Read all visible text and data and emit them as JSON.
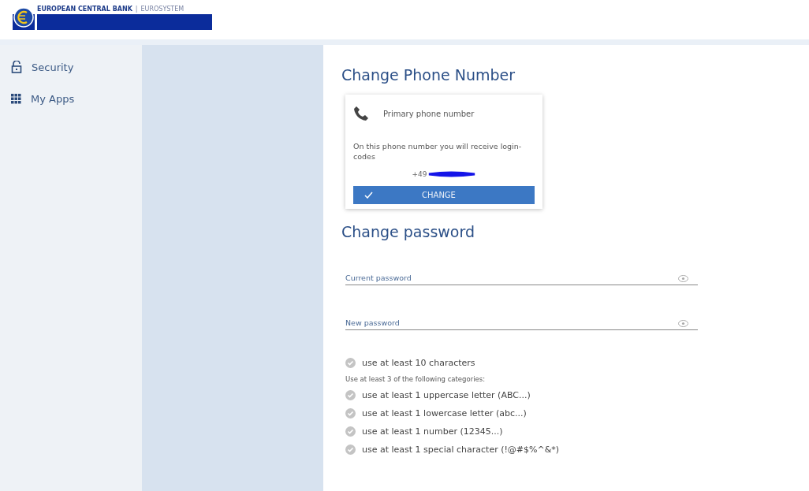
{
  "header": {
    "logo_title": "EUROPEAN CENTRAL BANK",
    "logo_separator": "|",
    "logo_subtitle": "EUROSYSTEM"
  },
  "sidebar": {
    "items": [
      {
        "label": "Security",
        "kind": "lock"
      },
      {
        "label": "My Apps",
        "kind": "apps"
      }
    ]
  },
  "phone_section": {
    "title": "Change Phone Number",
    "card_title": "Primary phone number",
    "description": "On this phone number you will receive login-codes",
    "phone_prefix": "+49",
    "button": "CHANGE"
  },
  "password_section": {
    "title": "Change password",
    "fields": [
      {
        "placeholder": "Current password"
      },
      {
        "placeholder": "New password"
      }
    ],
    "rules": [
      {
        "kind": "check",
        "text": "use at least 10 characters",
        "met": false
      },
      {
        "kind": "note",
        "text": "Use at least 3 of the following categories:"
      },
      {
        "kind": "check",
        "text": "use at least 1 uppercase letter (ABC...)",
        "met": false
      },
      {
        "kind": "check",
        "text": "use at least 1 lowercase letter (abc...)",
        "met": false
      },
      {
        "kind": "check",
        "text": "use at least 1 number (12345...)",
        "met": false
      },
      {
        "kind": "check",
        "text": "use at least 1 special character (!@#$%^&*)",
        "met": false
      }
    ]
  }
}
